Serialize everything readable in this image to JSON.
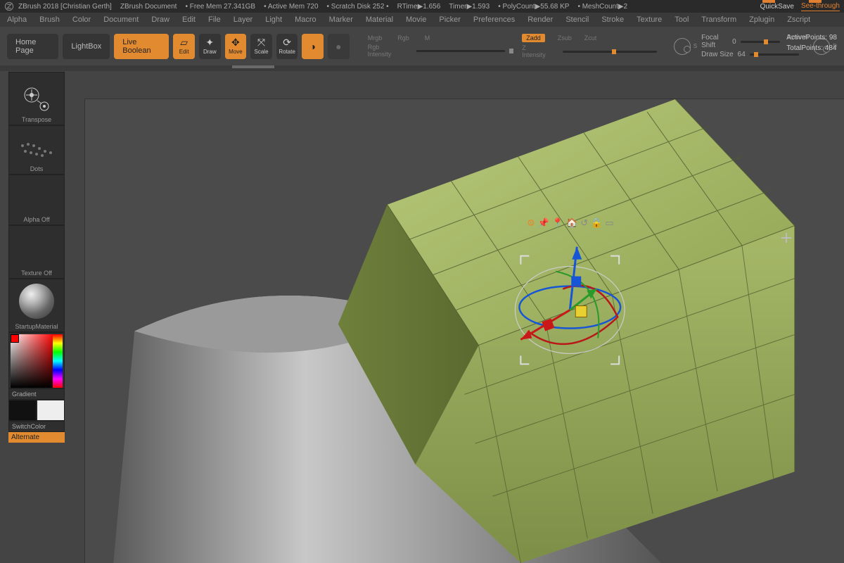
{
  "title": {
    "app": "ZBrush 2018 [Christian Gerth]",
    "doc": "ZBrush Document",
    "freemem": "• Free Mem 27.341GB",
    "activemem": "• Active Mem 720",
    "scratch": "• Scratch Disk 252 •",
    "rtime": "RTime▶1.656",
    "timer": "Timer▶1.593",
    "poly": "• PolyCount▶55.68 KP",
    "mesh": "• MeshCount▶2",
    "quicksave": "QuickSave",
    "seethrough": "See-through"
  },
  "menu": [
    "Alpha",
    "Brush",
    "Color",
    "Document",
    "Draw",
    "Edit",
    "File",
    "Layer",
    "Light",
    "Macro",
    "Marker",
    "Material",
    "Movie",
    "Picker",
    "Preferences",
    "Render",
    "Stencil",
    "Stroke",
    "Texture",
    "Tool",
    "Transform",
    "Zplugin",
    "Zscript"
  ],
  "toolbar": {
    "home": "Home Page",
    "lightbox": "LightBox",
    "liveboolean": "Live Boolean",
    "edit": "Edit",
    "draw": "Draw",
    "move": "Move",
    "scale": "Scale",
    "rotate": "Rotate",
    "sculptris": ""
  },
  "blend": {
    "mrgb": "Mrgb",
    "rgb": "Rgb",
    "m": "M",
    "intensity_label": "Rgb Intensity"
  },
  "zmode": {
    "zadd": "Zadd",
    "zsub": "Zsub",
    "zcut": "Zcut",
    "intensity_label": "Z Intensity"
  },
  "sliders": {
    "focal_label": "Focal Shift",
    "focal_value": "0",
    "draw_label": "Draw Size",
    "draw_value": "64",
    "dynamic": "Dynamic",
    "s_tag": "S",
    "d_tag": "D"
  },
  "stats": {
    "active_label": "ActivePoints:",
    "active_value": "98",
    "total_label": "TotalPoints:",
    "total_value": "484"
  },
  "palette": {
    "transpose": "Transpose",
    "dots": "Dots",
    "alpha": "Alpha Off",
    "texture": "Texture Off",
    "material": "StartupMaterial",
    "gradient": "Gradient",
    "switchcolor": "SwitchColor",
    "alternate": "Alternate"
  },
  "gizmo_icons": [
    "⚙",
    "📌",
    "📍",
    "🏠",
    "↺",
    "🔒",
    "▭"
  ]
}
